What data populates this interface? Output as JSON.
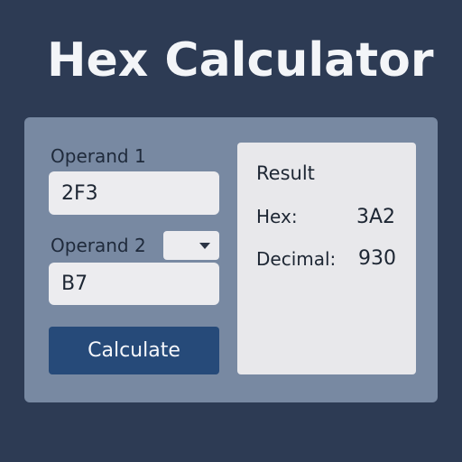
{
  "app": {
    "title": "Hex Calculator"
  },
  "form": {
    "operand1_label": "Operand 1",
    "operand1_value": "2F3",
    "operand2_label": "Operand 2",
    "operand2_value": "B7",
    "operator_selected": "",
    "calculate_label": "Calculate"
  },
  "result": {
    "title": "Result",
    "hex_label": "Hex:",
    "hex_value": "3A2",
    "decimal_label": "Decimal:",
    "decimal_value": "930"
  },
  "colors": {
    "background": "#2d3b54",
    "panel": "#7889a2",
    "button": "#264a79",
    "field": "#ececef"
  }
}
